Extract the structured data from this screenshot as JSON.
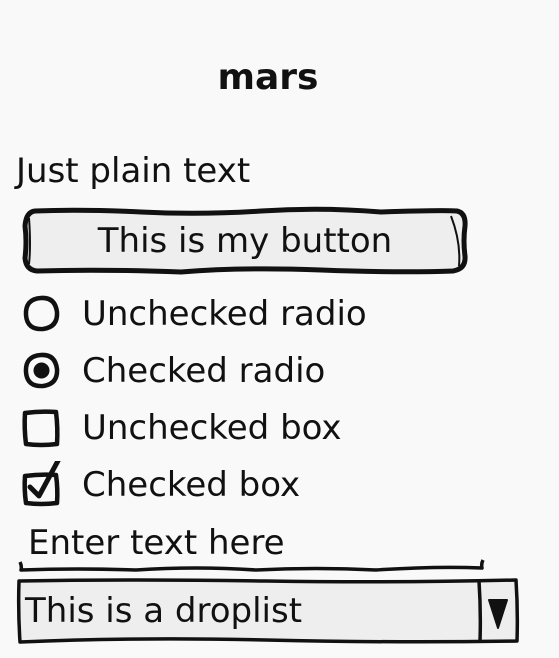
{
  "page": {
    "title": "mars",
    "plain_text": "Just plain text"
  },
  "button": {
    "label": "This is my button"
  },
  "options": [
    {
      "type": "radio",
      "label": "Unchecked radio",
      "checked": false
    },
    {
      "type": "radio",
      "label": "Checked radio",
      "checked": true
    },
    {
      "type": "checkbox",
      "label": "Unchecked box",
      "checked": false
    },
    {
      "type": "checkbox",
      "label": "Checked box",
      "checked": true
    }
  ],
  "text_field": {
    "placeholder": "Enter text here"
  },
  "droplist": {
    "selected": "This is a droplist"
  },
  "colors": {
    "ink": "#111111",
    "background": "#f9f9f9",
    "control_fill": "#eeeeee"
  }
}
